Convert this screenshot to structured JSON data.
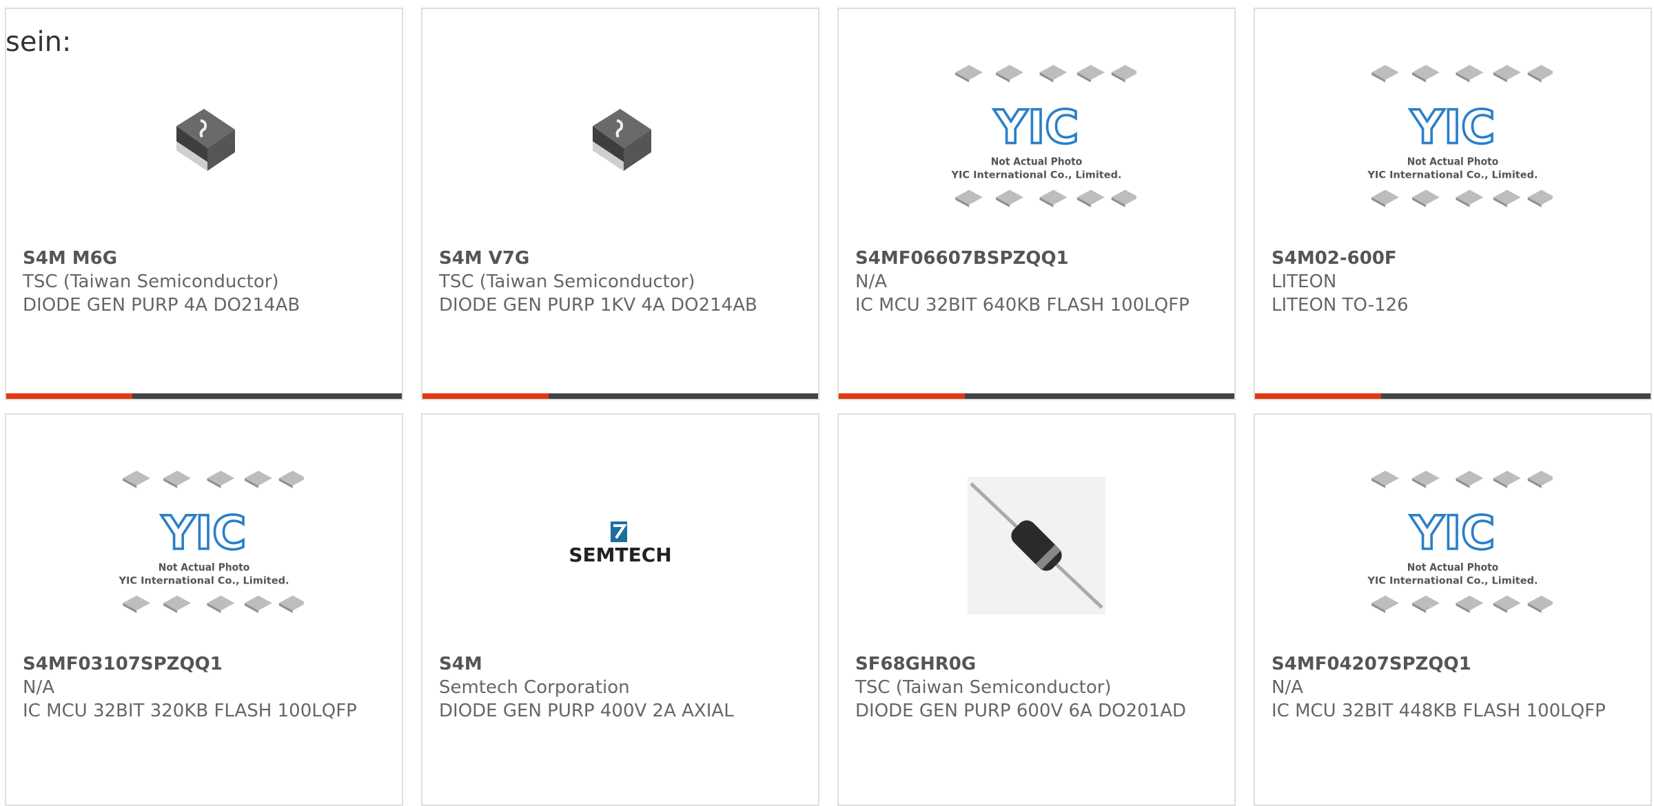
{
  "lead_text": "sein:",
  "colors": {
    "accent": "#e03a10",
    "bar": "#444444",
    "border": "#dedede"
  },
  "cards": [
    {
      "part_number": "S4M M6G",
      "manufacturer": "TSC (Taiwan Semiconductor)",
      "description": "DIODE GEN PURP 4A DO214AB",
      "image": "smd-diode-package"
    },
    {
      "part_number": "S4M V7G",
      "manufacturer": "TSC (Taiwan Semiconductor)",
      "description": "DIODE GEN PURP 1KV 4A DO214AB",
      "image": "smd-diode-package"
    },
    {
      "part_number": "S4MF06607BSPZQQ1",
      "manufacturer": "N/A",
      "description": "IC MCU 32BIT 640KB FLASH 100LQFP",
      "image": "yic-placeholder",
      "image_caption_1": "Not Actual Photo",
      "image_caption_2": "YIC International Co., Limited.",
      "logo_text": "YIC"
    },
    {
      "part_number": "S4M02-600F",
      "manufacturer": "LITEON",
      "description": "LITEON TO-126",
      "image": "yic-placeholder",
      "image_caption_1": "Not Actual Photo",
      "image_caption_2": "YIC International Co., Limited.",
      "logo_text": "YIC"
    },
    {
      "part_number": "S4MF03107SPZQQ1",
      "manufacturer": "N/A",
      "description": "IC MCU 32BIT 320KB FLASH 100LQFP",
      "image": "yic-placeholder",
      "image_caption_1": "Not Actual Photo",
      "image_caption_2": "YIC International Co., Limited.",
      "logo_text": "YIC"
    },
    {
      "part_number": "S4M",
      "manufacturer": "Semtech Corporation",
      "description": "DIODE GEN PURP 400V 2A AXIAL",
      "image": "semtech-logo",
      "logo_text": "SEMTECH"
    },
    {
      "part_number": "SF68GHR0G",
      "manufacturer": "TSC (Taiwan Semiconductor)",
      "description": "DIODE GEN PURP 600V 6A DO201AD",
      "image": "axial-diode"
    },
    {
      "part_number": "S4MF04207SPZQQ1",
      "manufacturer": "N/A",
      "description": "IC MCU 32BIT 448KB FLASH 100LQFP",
      "image": "yic-placeholder",
      "image_caption_1": "Not Actual Photo",
      "image_caption_2": "YIC International Co., Limited.",
      "logo_text": "YIC"
    }
  ]
}
